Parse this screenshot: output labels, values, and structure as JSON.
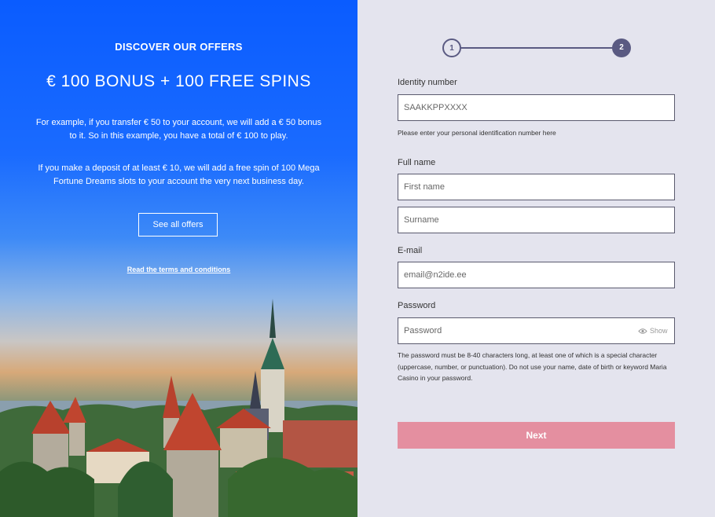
{
  "promo": {
    "eyebrow": "DISCOVER OUR OFFERS",
    "headline": "€ 100 BONUS + 100 FREE SPINS",
    "paragraph1": "For example, if you transfer € 50 to your account, we will add a € 50 bonus to it. So in this example, you have a total of € 100 to play.",
    "paragraph2": "If you make a deposit of at least € 10, we will add a free spin of 100 Mega Fortune Dreams slots to your account the very next business day.",
    "offers_button": "See all offers",
    "terms_link": "Read the terms and conditions"
  },
  "stepper": {
    "step1": "1",
    "step2": "2",
    "active_step": 2
  },
  "form": {
    "identity_label": "Identity number",
    "identity_placeholder": "SAAKKPPXXXX",
    "identity_hint": "Please enter your personal identification number here",
    "fullname_label": "Full name",
    "firstname_placeholder": "First name",
    "surname_placeholder": "Surname",
    "email_label": "E-mail",
    "email_placeholder": "email@n2ide.ee",
    "password_label": "Password",
    "password_placeholder": "Password",
    "show_label": "Show",
    "password_hint": "The password must be 8-40 characters long, at least one of which is a special character (uppercase, number, or punctuation). Do not use your name, date of birth or keyword Maria Casino in your password.",
    "next_button": "Next"
  },
  "colors": {
    "accent": "#5a5a82",
    "next_button": "#e48fa0",
    "promo_blue": "#0a5cff"
  }
}
